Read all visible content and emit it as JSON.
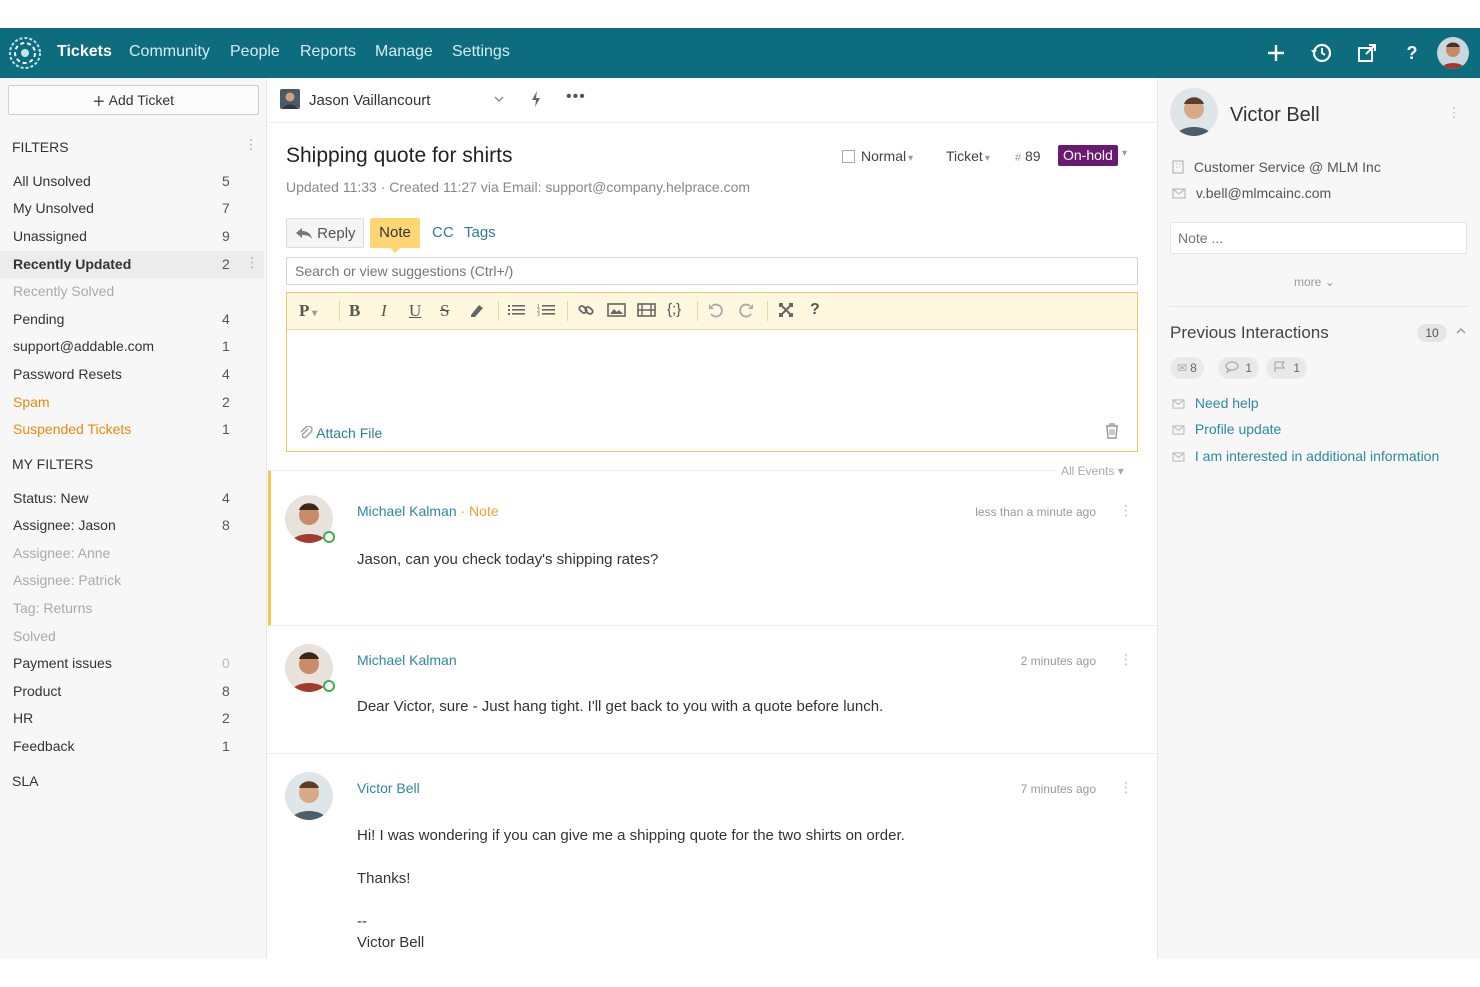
{
  "nav": {
    "items": [
      "Tickets",
      "Community",
      "People",
      "Reports",
      "Manage",
      "Settings"
    ]
  },
  "sidebar": {
    "add_ticket": "Add Ticket",
    "filters_heading": "FILTERS",
    "filters": [
      {
        "label": "All Unsolved",
        "count": "5"
      },
      {
        "label": "My Unsolved",
        "count": "7"
      },
      {
        "label": "Unassigned",
        "count": "9"
      },
      {
        "label": "Recently Updated",
        "count": "2"
      },
      {
        "label": "Recently Solved",
        "count": ""
      },
      {
        "label": "Pending",
        "count": "4"
      },
      {
        "label": "support@addable.com",
        "count": "1"
      },
      {
        "label": "Password Resets",
        "count": "4"
      },
      {
        "label": "Spam",
        "count": "2"
      },
      {
        "label": "Suspended Tickets",
        "count": "1"
      }
    ],
    "my_filters_heading": "MY FILTERS",
    "my_filters": [
      {
        "label": "Status: New",
        "count": "4"
      },
      {
        "label": "Assignee: Jason",
        "count": "8"
      },
      {
        "label": "Assignee: Anne",
        "count": ""
      },
      {
        "label": "Assignee: Patrick",
        "count": ""
      },
      {
        "label": "Tag: Returns",
        "count": ""
      },
      {
        "label": "Solved",
        "count": ""
      },
      {
        "label": "Payment issues",
        "count": "0"
      },
      {
        "label": "Product",
        "count": "8"
      },
      {
        "label": "HR",
        "count": "2"
      },
      {
        "label": "Feedback",
        "count": "1"
      }
    ],
    "sla_heading": "SLA"
  },
  "toolbar": {
    "assignee": "Jason Vaillancourt"
  },
  "ticket": {
    "title": "Shipping quote for shirts",
    "meta": "Updated 11:33 · Created 11:27 via Email: support@company.helprace.com",
    "priority": "Normal",
    "type": "Ticket",
    "number_hash": "#",
    "number": "89",
    "status": "On-hold"
  },
  "composer": {
    "tabs": {
      "reply": "Reply",
      "note": "Note",
      "cc": "CC",
      "tags": "Tags"
    },
    "search_placeholder": "Search or view suggestions (Ctrl+/)",
    "attach": "Attach File",
    "all_events": "All Events"
  },
  "events": [
    {
      "author": "Michael Kalman",
      "tag": "· Note",
      "time": "less than a minute ago",
      "body": [
        "Jason, can you check today's shipping rates?"
      ]
    },
    {
      "author": "Michael Kalman",
      "tag": "",
      "time": "2 minutes ago",
      "body": [
        "Dear Victor, sure - Just hang tight. I'll get back to you with a quote before lunch."
      ]
    },
    {
      "author": "Victor Bell",
      "tag": "",
      "time": "7 minutes ago",
      "body": [
        "Hi! I was wondering if you can give me a shipping quote for the two shirts on order.",
        "Thanks!",
        "--",
        "Victor Bell"
      ]
    }
  ],
  "contact": {
    "name": "Victor Bell",
    "company": "Customer Service @ MLM Inc",
    "email": "v.bell@mlmcainc.com",
    "note_placeholder": "Note ...",
    "more": "more",
    "prev_title": "Previous Interactions",
    "prev_count": "10",
    "chips": {
      "email": "8",
      "chat": "1",
      "flag": "1"
    },
    "interactions": [
      "Need help",
      "Profile update",
      "I am interested in additional information"
    ]
  },
  "colors": {
    "nav_bg": "#0e6c7f",
    "status_onhold": "#6a1b6f",
    "note_accent": "#ffd673",
    "link": "#2b8aa0",
    "spam_orange": "#e8890c"
  }
}
